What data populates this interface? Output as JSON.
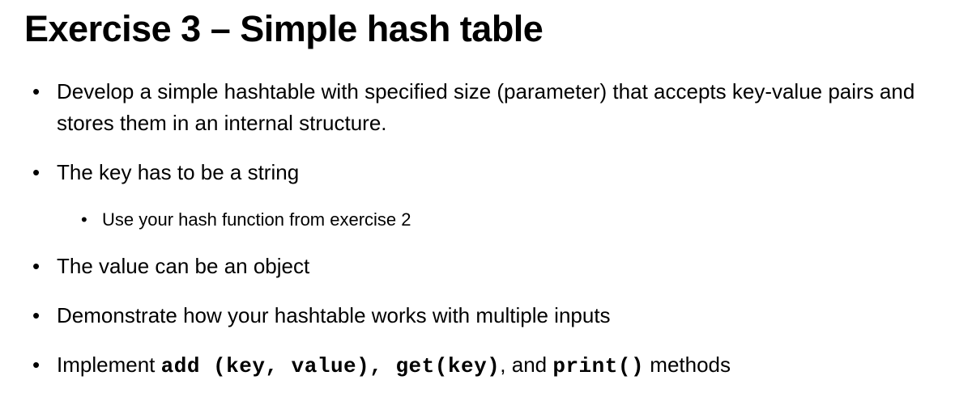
{
  "title": "Exercise 3 – Simple hash table",
  "bullets": {
    "b1": "Develop a simple hashtable with specified size (parameter) that accepts key-value pairs and stores them in an internal structure.",
    "b2": "The key has to be a string",
    "b2_sub": "Use your hash function from exercise 2",
    "b3": "The value can be an object",
    "b4": "Demonstrate how your hashtable works with multiple inputs",
    "b5_pre": "Implement ",
    "b5_code1": "add (key, value), get(key)",
    "b5_mid": ", and ",
    "b5_code2": "print()",
    "b5_post": " methods"
  }
}
